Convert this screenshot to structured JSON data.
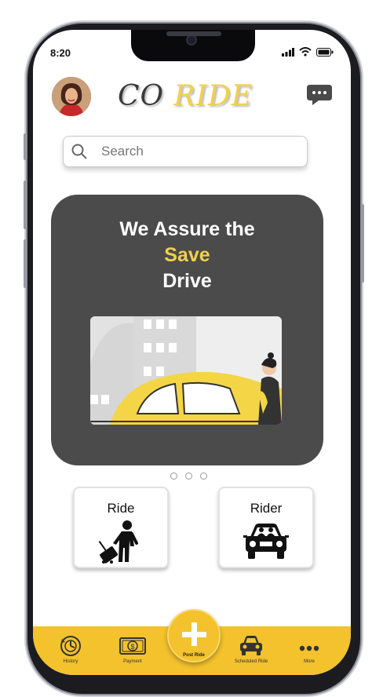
{
  "status_bar": {
    "time": "8:20"
  },
  "header": {
    "logo_part1": "CO",
    "logo_part2": "RIDE",
    "avatar_icon": "user-avatar",
    "chat_icon": "chat-bubble-icon"
  },
  "search": {
    "placeholder": "Search",
    "icon": "search-icon"
  },
  "hero": {
    "line1": "We Assure the",
    "line2": "Save",
    "line3": "Drive",
    "accent_color": "#f1d04b",
    "background_color": "#4b4b4b"
  },
  "carousel": {
    "page_count": 3
  },
  "options": [
    {
      "label": "Ride",
      "icon": "traveler-with-luggage-icon"
    },
    {
      "label": "Rider",
      "icon": "car-with-passengers-icon"
    }
  ],
  "bottom_nav": {
    "items": [
      {
        "label": "History",
        "icon": "history-icon"
      },
      {
        "label": "Payment",
        "icon": "payment-icon"
      },
      {
        "label": "Post Ride",
        "icon": "plus-icon"
      },
      {
        "label": "Scheduled Ride",
        "icon": "car-icon"
      },
      {
        "label": "More",
        "icon": "more-dots-icon"
      }
    ],
    "bar_color": "#f3c22c"
  }
}
